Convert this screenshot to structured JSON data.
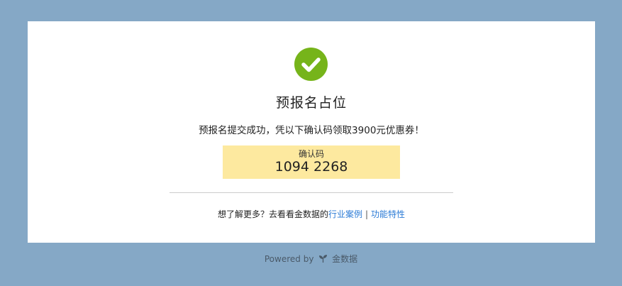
{
  "colors": {
    "page_background": "#85a8c6",
    "card_background": "#ffffff",
    "success": "#76b41a",
    "code_background": "#fde99f",
    "link": "#2b7bd6"
  },
  "status_icon": "check-circle-icon",
  "title": "预报名占位",
  "message": "预报名提交成功，凭以下确认码领取3900元优惠券！",
  "confirmation": {
    "label": "确认码",
    "code": "1094 2268"
  },
  "more": {
    "prompt": "想了解更多？去看看金数据的",
    "link_cases": "行业案例",
    "separator": "|",
    "link_features": "功能特性"
  },
  "footer": {
    "powered_by": "Powered by",
    "brand": "金数据",
    "brand_icon": "jinshuju-leaf-icon"
  }
}
